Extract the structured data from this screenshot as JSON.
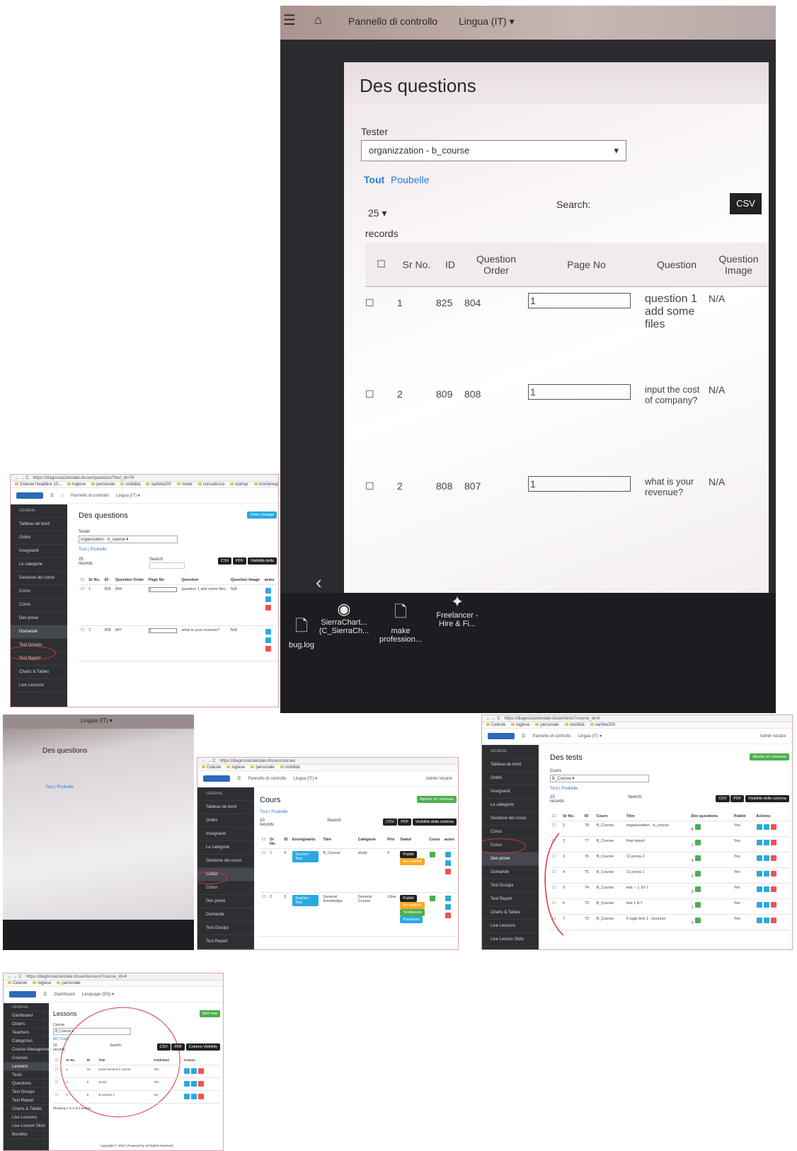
{
  "photo": {
    "menu_icon": "hamburger-icon",
    "home_icon": "home-icon",
    "nav": [
      "Pannello di controllo",
      "Lingua (IT) ▾"
    ],
    "title": "Des questions",
    "tester_label": "Tester",
    "tester_value": "organizzation - b_course",
    "filter_all": "Tout",
    "filter_trash": "Poubelle",
    "page_size": "25",
    "records": "records",
    "search_label": "Search:",
    "csv": "CSV",
    "headers": [
      "Sr No.",
      "ID",
      "Question Order",
      "Page No",
      "Question",
      "Question Image"
    ],
    "rows": [
      {
        "sr": "1",
        "id": "825",
        "order": "804",
        "page": "1",
        "question": "question 1 add some files",
        "image": "N/A"
      },
      {
        "sr": "2",
        "id": "809",
        "order": "808",
        "page": "1",
        "question": "input the cost of company?",
        "image": "N/A"
      },
      {
        "sr": "2",
        "id": "808",
        "order": "807",
        "page": "1",
        "question": "what is your revenue?",
        "image": "N/A"
      }
    ],
    "desktop_icons": [
      "bug.log",
      "SierraChart... (C_SierraCh...",
      "make profession...",
      "Freelancer - Hire & Fi..."
    ]
  },
  "shot1": {
    "url": "https://diagnosiaziendale.it/user/questions?test_id=78",
    "bookmarks": [
      "Celeste Headline 10...",
      "inglese",
      "personale",
      "visibilità",
      "sarfete200",
      "mode",
      "consulenza",
      "startup",
      "montenegro",
      "salute",
      "cors"
    ],
    "nav": "Pannello di controllo",
    "lang": "Lingua (IT) ▾",
    "section": "GÉNÉRAL",
    "sidebar": [
      "Tableau de bord",
      "Ordini",
      "Insegnanti",
      "Le categorie",
      "Gestione del corso",
      "Corso",
      "Corso",
      "Des prove",
      "Domande",
      "Test Groups",
      "Test Report",
      "Charts & Tables",
      "Live Lessons"
    ],
    "title": "Des questions",
    "order_btn": "Order change",
    "tester_label": "Tester",
    "tester_value": "organization - b_course",
    "filter": "Tout | Poubelle",
    "page_size": "25",
    "records": "records",
    "search": "Search",
    "buttons": [
      "CSV",
      "PDF",
      "Visibilità della"
    ],
    "headers": [
      "Sr No.",
      "ID",
      "Question Order",
      "Page No",
      "Question",
      "Question Image",
      "actes"
    ],
    "rows": [
      {
        "sr": "1",
        "id": "805",
        "order": "804",
        "page": "1",
        "question": "question 1 add some files",
        "image": "N/A"
      },
      {
        "sr": "2",
        "id": "808",
        "order": "807",
        "page": "1",
        "question": "what is your revenue?",
        "image": "N/A"
      }
    ]
  },
  "shot2": {
    "url": "https://diagnosiaziendale.it/user/courses",
    "nav": "Pannello di controllo",
    "lang": "Lingua (IT) ▾",
    "admin": "Admin Istrator",
    "section": "GÉNÉRAL",
    "sidebar": [
      "Tableau de bord",
      "Ordini",
      "Insegnanti",
      "Le categorie",
      "Gestione del corso",
      "Corso",
      "Corso",
      "Des prove",
      "Domande",
      "Test Groups",
      "Test Report",
      "Charts & Tables",
      "Live Lessons"
    ],
    "title": "Cours",
    "add_btn": "Ajouter un nouveau",
    "filter": "Tout | Poubelle",
    "page_size": "10",
    "records": "records",
    "search": "Search:",
    "buttons": [
      "CSV",
      "PDF",
      "Visibilità della colonna"
    ],
    "headers": [
      "Sr No.",
      "ID",
      "Enseignants",
      "Titre",
      "Catégorie",
      "Prix",
      "Statut",
      "Cours",
      "actes"
    ],
    "rows": [
      {
        "sr": "1",
        "id": "6",
        "teacher": "Teacher Test",
        "title": "B_Course",
        "category": "study",
        "price": "0",
        "status": [
          "Publié",
          "En vedette"
        ]
      },
      {
        "sr": "2",
        "id": "5",
        "teacher": "Teacher Test",
        "title": "General Knowledge",
        "category": "General Course",
        "price": "Libre",
        "status": [
          "Publié",
          "En vedette",
          "Tendances",
          "Populaire"
        ]
      }
    ]
  },
  "shot3": {
    "url": "https://diagnosiaziendale.it/user/tests?course_id=6",
    "nav": "Pannello di controllo",
    "lang": "Lingua (IT) ▾",
    "admin": "Admin Istrator",
    "section": "GÉNÉRAL",
    "sidebar": [
      "Tableau de bord",
      "Ordini",
      "Insegnanti",
      "Le categorie",
      "Gestione del corso",
      "Corso",
      "Corso",
      "Des prove",
      "Domande",
      "Test Groups",
      "Test Report",
      "Charts & Tables",
      "Live Lessons",
      "Live Lesson Slots",
      "gruppi"
    ],
    "title": "Des tests",
    "add_btn": "Ajouter un nouveau",
    "course_label": "Cours",
    "course_value": "B_Course",
    "filter": "Tout | Poubelle",
    "page_size": "10",
    "records": "records",
    "search": "Search:",
    "buttons": [
      "CSV",
      "PDF",
      "Visibilità della colonna"
    ],
    "headers": [
      "Sr No.",
      "ID",
      "Cours",
      "Titre",
      "Des questions",
      "Publié",
      "Actions"
    ],
    "rows": [
      {
        "sr": "1",
        "id": "78",
        "course": "B_Course",
        "title": "organizzation - b_course",
        "q": "8",
        "pub": "Yes"
      },
      {
        "sr": "2",
        "id": "77",
        "course": "B_Course",
        "title": "final report",
        "q": "1",
        "pub": "Yes"
      },
      {
        "sr": "3",
        "id": "76",
        "course": "B_Course",
        "title": "11 prova 2",
        "q": "4",
        "pub": "Yes"
      },
      {
        "sr": "4",
        "id": "75",
        "course": "B_Course",
        "title": "11 prova 1",
        "q": "2",
        "pub": "Yes"
      },
      {
        "sr": "5",
        "id": "74",
        "course": "B_Course",
        "title": "test -- 1 10-7",
        "q": "3",
        "pub": "Yes"
      },
      {
        "sr": "6",
        "id": "73",
        "course": "B_Course",
        "title": "test 1 8-7",
        "q": "2",
        "pub": "Yes"
      },
      {
        "sr": "7",
        "id": "72",
        "course": "B_Course",
        "title": "9 lugio test 1 - bcourse",
        "q": "2",
        "pub": "Yes"
      }
    ]
  },
  "shot4": {
    "url": "https://diagnosiaziendale.it/user/lessons?course_id=6",
    "nav": "Dashboard",
    "lang": "Language (EN) ▾",
    "section": "GENERAL",
    "sidebar": [
      "Dashboard",
      "Orders",
      "Teachers",
      "Categories",
      "Course Management",
      "Courses",
      "Lessons",
      "Tests",
      "Questions",
      "Test Groups",
      "Test Report",
      "Charts & Tables",
      "Live Lessons",
      "Live Lesson Slots",
      "Bundles"
    ],
    "title": "Lessons",
    "add_btn": "Add new",
    "course_label": "Course",
    "course_value": "B_Course",
    "filter": "All | Trash",
    "page_size": "10",
    "records": "records",
    "search": "Search:",
    "buttons": [
      "CSV",
      "PDF",
      "Column Visibility"
    ],
    "headers": [
      "Sr No.",
      "ID",
      "Title",
      "Published",
      "Actions"
    ],
    "rows": [
      {
        "sr": "1",
        "id": "10",
        "title": "prova lezione b course",
        "pub": "Yes"
      },
      {
        "sr": "2",
        "id": "9",
        "title": "prova",
        "pub": "Yes"
      },
      {
        "sr": "3",
        "id": "8",
        "title": "B Lesson 1",
        "pub": "No"
      }
    ],
    "showing": "Showing 1 to 3 of 3 entries",
    "footer": "Copyright © 2022 | Powered by All Rights Reserved"
  },
  "photo2": {
    "title": "Des questions",
    "nav": "Lingua (IT) ▾",
    "filter": "Tout | Poubelle"
  }
}
